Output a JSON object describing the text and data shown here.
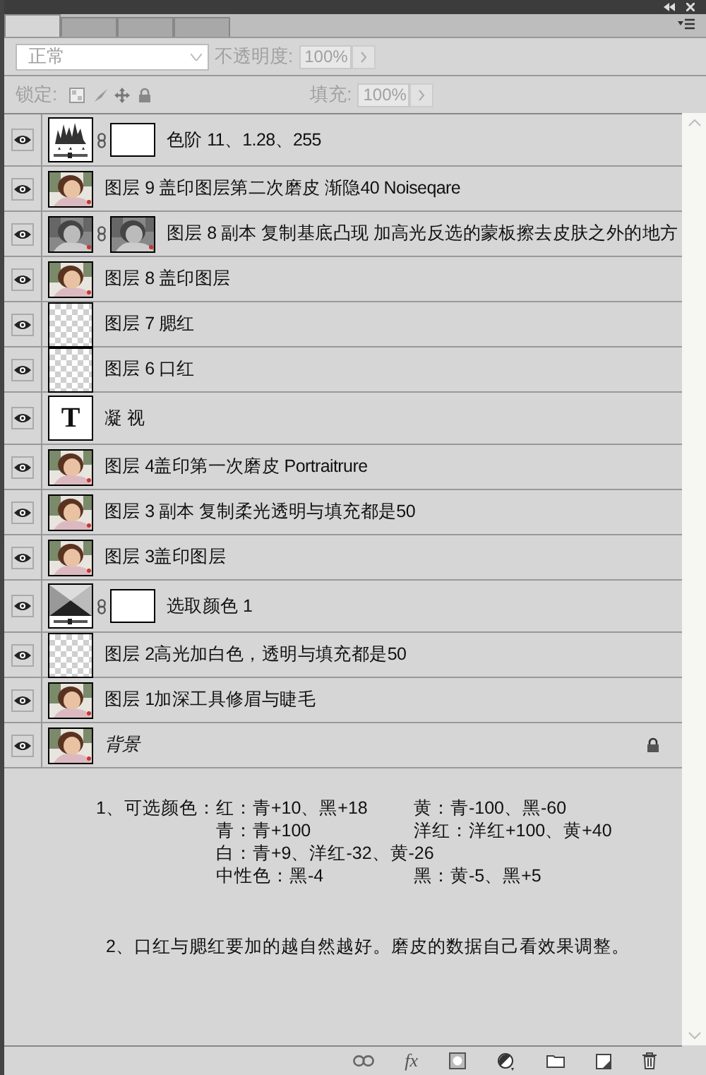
{
  "tabs": [
    {
      "selected": true
    },
    {
      "selected": false
    },
    {
      "selected": false
    },
    {
      "selected": false
    }
  ],
  "options": {
    "blend_mode": "正常",
    "opacity_label": "不透明度:",
    "opacity": "100%",
    "lock_label": "锁定:",
    "fill_label": "填充:",
    "fill": "100%",
    "disabled": true
  },
  "layers": [
    {
      "name": "色阶  11、1.28、255",
      "thumb": {
        "kind": "levels"
      },
      "mask": {
        "kind": "white"
      },
      "visible": true,
      "locked": false
    },
    {
      "name": "图层 9 盖印图层第二次磨皮 渐隐40 Noiseqare",
      "visible": true,
      "locked": false
    },
    {
      "name": "图层 8 副本  复制基底凸现   加高光反选的蒙板擦去皮肤之外的地方",
      "thumb": {
        "kind": "grey"
      },
      "visible": true,
      "locked": false
    },
    {
      "name": "图层 8 盖印图层",
      "visible": true,
      "locked": false
    },
    {
      "name": "图层 7 腮红",
      "thumb": {
        "kind": "transparent"
      },
      "visible": true,
      "locked": false
    },
    {
      "name": "图层 6 口红",
      "thumb": {
        "kind": "transparent"
      },
      "visible": true,
      "locked": false
    },
    {
      "name": "凝 视",
      "thumb": {
        "kind": "text",
        "glyph": "T"
      },
      "visible": true,
      "locked": false
    },
    {
      "name": "图层 4盖印第一次磨皮 Portraitrure",
      "visible": true,
      "locked": false
    },
    {
      "name": "图层 3 副本  复制柔光透明与填充都是50",
      "visible": true,
      "locked": false
    },
    {
      "name": "图层 3盖印图层",
      "visible": true,
      "locked": false
    },
    {
      "name": "选取颜色 1",
      "thumb": {
        "kind": "selective"
      },
      "mask": {
        "kind": "white"
      },
      "visible": true,
      "locked": false
    },
    {
      "name": "图层 2高光加白色，透明与填充都是50",
      "thumb": {
        "kind": "transparent"
      },
      "visible": true,
      "locked": false
    },
    {
      "name": "图层 1加深工具修眉与睫毛",
      "visible": true,
      "locked": false
    },
    {
      "name": "背景",
      "visible": true,
      "locked": true
    }
  ],
  "notes": [
    {
      "label": "1、可选颜色：",
      "rows": [
        [
          "红：青+10、黑+18",
          "黄：青-100、黑-60"
        ],
        [
          "青：青+100",
          "洋红：洋红+100、黄+40"
        ],
        [
          "白：青+9、洋红-32、黄-26"
        ],
        [
          "中性色：黑-4",
          "黑：黄-5、黑+5"
        ]
      ]
    },
    {
      "text": "2、口红与腮红要加的越自然越好。磨皮的数据自己看效果调整。"
    }
  ],
  "toolbar": [
    {
      "kind": "link"
    },
    {
      "kind": "fx",
      "label": "fx"
    },
    {
      "kind": "mask"
    },
    {
      "kind": "adjust"
    },
    {
      "kind": "folder"
    },
    {
      "kind": "new"
    },
    {
      "kind": "trash"
    }
  ]
}
